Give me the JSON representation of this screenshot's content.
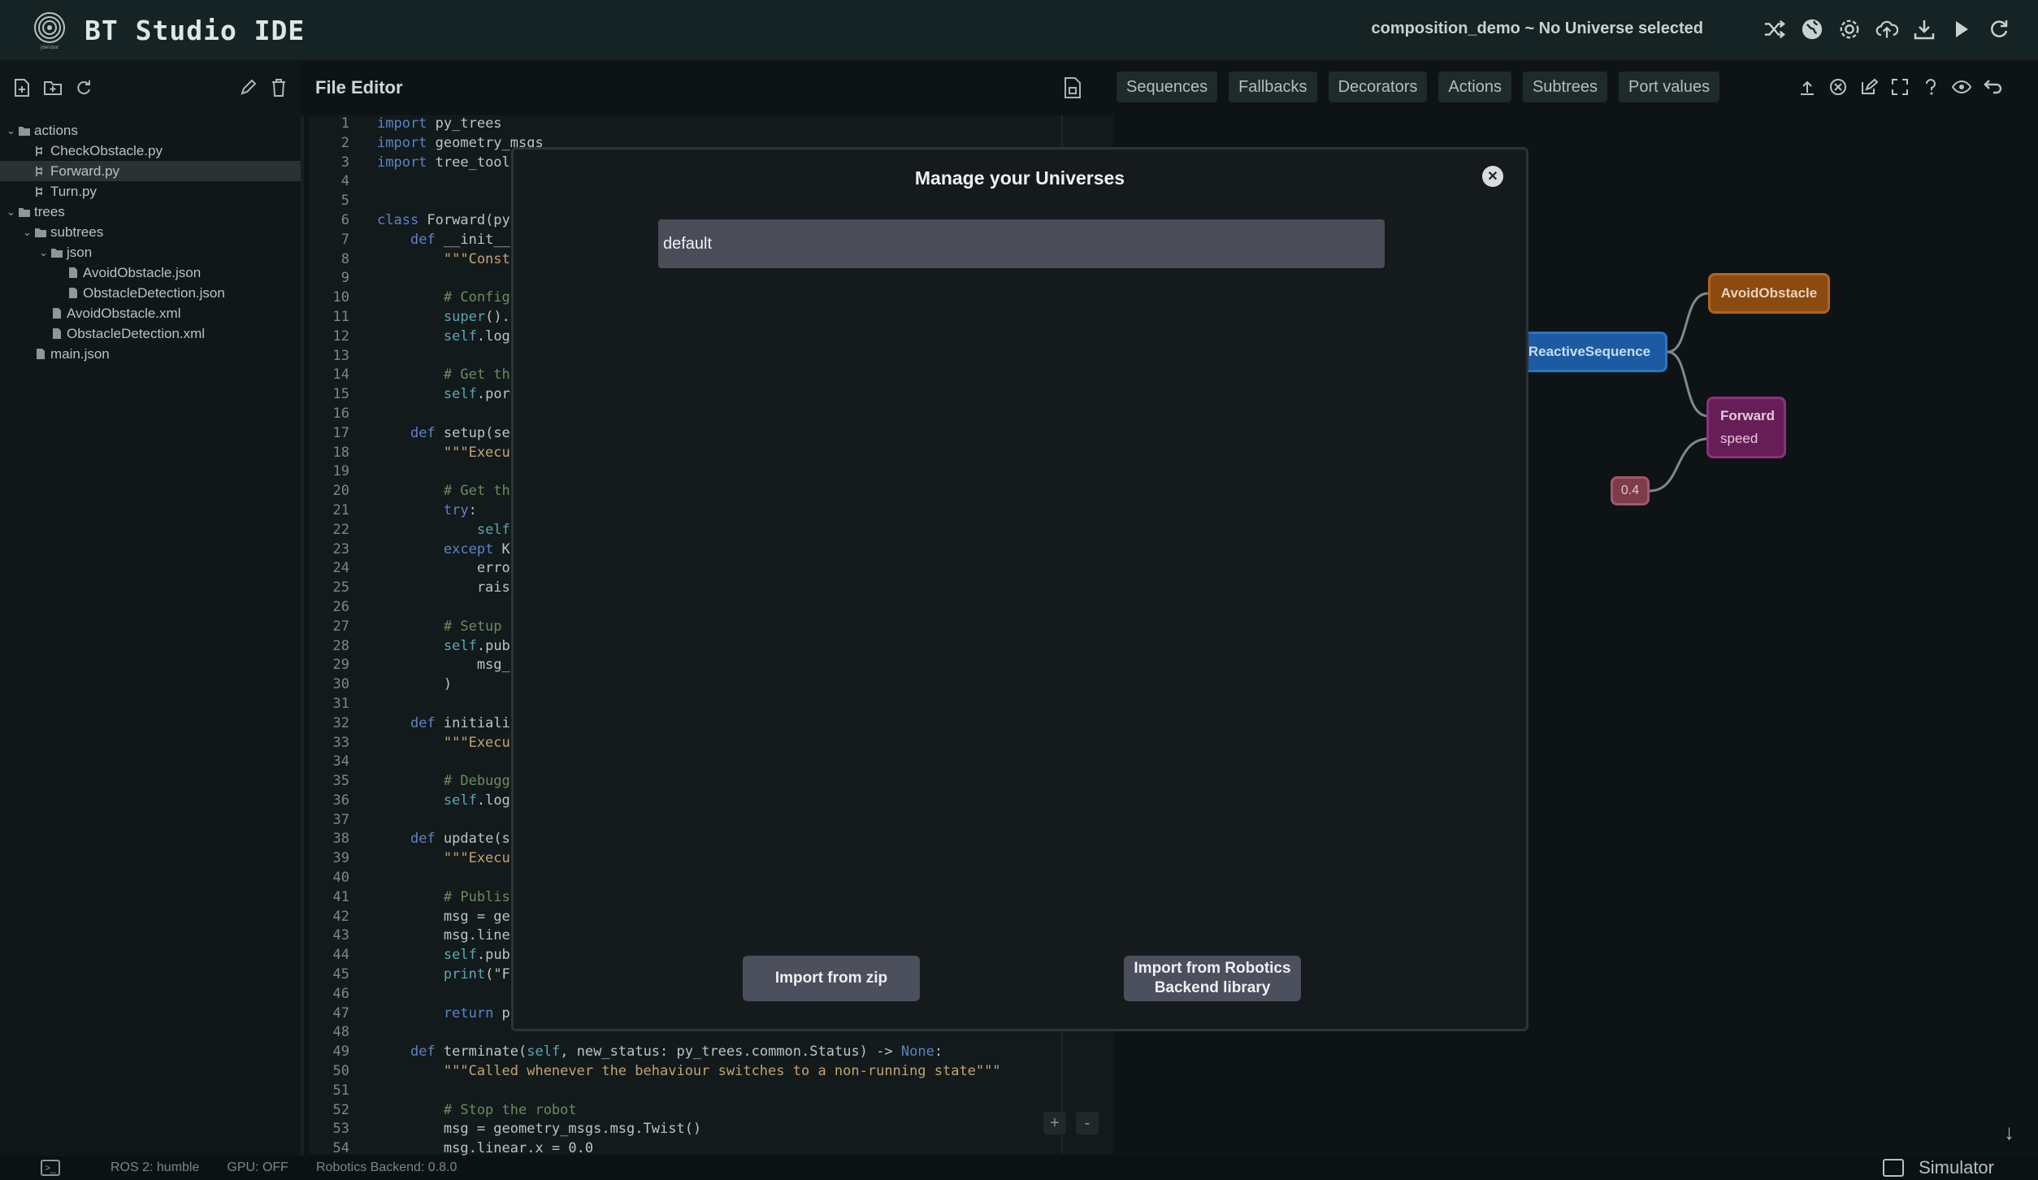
{
  "header": {
    "app_title": "BT Studio IDE",
    "logo_caption": "jderobot",
    "project_status": "composition_demo ~ No Universe selected",
    "icons": [
      "shuffle-icon",
      "globe-icon",
      "settings-icon",
      "cloud-upload-icon",
      "download-icon",
      "play-icon",
      "refresh-icon"
    ]
  },
  "sidebar": {
    "toolbar_icons": [
      "new-file-icon",
      "new-folder-icon",
      "refresh-icon",
      "rename-icon",
      "delete-icon"
    ],
    "tree": [
      {
        "label": "actions",
        "type": "folder",
        "depth": 0,
        "expanded": true
      },
      {
        "label": "CheckObstacle.py",
        "type": "action-file",
        "depth": 1
      },
      {
        "label": "Forward.py",
        "type": "action-file",
        "depth": 1,
        "selected": true
      },
      {
        "label": "Turn.py",
        "type": "action-file",
        "depth": 1
      },
      {
        "label": "trees",
        "type": "folder",
        "depth": 0,
        "expanded": true
      },
      {
        "label": "subtrees",
        "type": "folder",
        "depth": 1,
        "expanded": true
      },
      {
        "label": "json",
        "type": "folder",
        "depth": 2,
        "expanded": true
      },
      {
        "label": "AvoidObstacle.json",
        "type": "file",
        "depth": 3
      },
      {
        "label": "ObstacleDetection.json",
        "type": "file",
        "depth": 3
      },
      {
        "label": "AvoidObstacle.xml",
        "type": "file",
        "depth": 2
      },
      {
        "label": "ObstacleDetection.xml",
        "type": "file",
        "depth": 2
      },
      {
        "label": "main.json",
        "type": "file",
        "depth": 1
      }
    ]
  },
  "editor": {
    "title": "File Editor",
    "lines": [
      "import py_trees",
      "import geometry_msgs",
      "import tree_tool",
      "",
      "",
      "class Forward(py",
      "    def __init__",
      "        \"\"\"Const",
      "",
      "        # Config",
      "        super().",
      "        self.log",
      "",
      "        # Get th",
      "        self.por",
      "",
      "    def setup(se",
      "        \"\"\"Execu",
      "",
      "        # Get th",
      "        try:",
      "            self",
      "        except K",
      "            erro",
      "            rais",
      "",
      "        # Setup",
      "        self.pub",
      "            msg_",
      "        )",
      "",
      "    def initiali",
      "        \"\"\"Execu",
      "",
      "        # Debugg",
      "        self.log",
      "",
      "    def update(s",
      "        \"\"\"Execu",
      "",
      "        # Publis",
      "        msg = ge",
      "        msg.line",
      "        self.pub",
      "        print(\"F",
      "",
      "        return p",
      "",
      "    def terminate(self, new_status: py_trees.common.Status) -> None:",
      "        \"\"\"Called whenever the behaviour switches to a non-running state\"\"\"",
      "",
      "        # Stop the robot",
      "        msg = geometry_msgs.msg.Twist()",
      "        msg.linear.x = 0.0"
    ],
    "zoom_in": "+",
    "zoom_out": "-"
  },
  "graph": {
    "toolbar": [
      "Sequences",
      "Fallbacks",
      "Decorators",
      "Actions",
      "Subtrees",
      "Port values"
    ],
    "icons": [
      "upload-icon",
      "close-circle-icon",
      "edit-icon",
      "fullscreen-icon",
      "help-icon",
      "eye-icon",
      "return-icon"
    ],
    "nodes": {
      "avoid": "AvoidObstacle",
      "reactive": "ReactiveSequence",
      "forward": "Forward",
      "forward_port": "speed",
      "value": "0.4"
    },
    "colors": {
      "avoid": "#8b4a10",
      "reactive": "#1c5ba2",
      "forward": "#671e56",
      "value": "#7d3c4a"
    }
  },
  "statusbar": {
    "ros": "ROS 2: humble",
    "gpu": "GPU: OFF",
    "backend": "Robotics Backend: 0.8.0",
    "simulator": "Simulator"
  },
  "modal": {
    "title": "Manage your Universes",
    "universes": [
      "default"
    ],
    "import_zip": "Import from zip",
    "import_library": "Import from Robotics Backend library"
  }
}
